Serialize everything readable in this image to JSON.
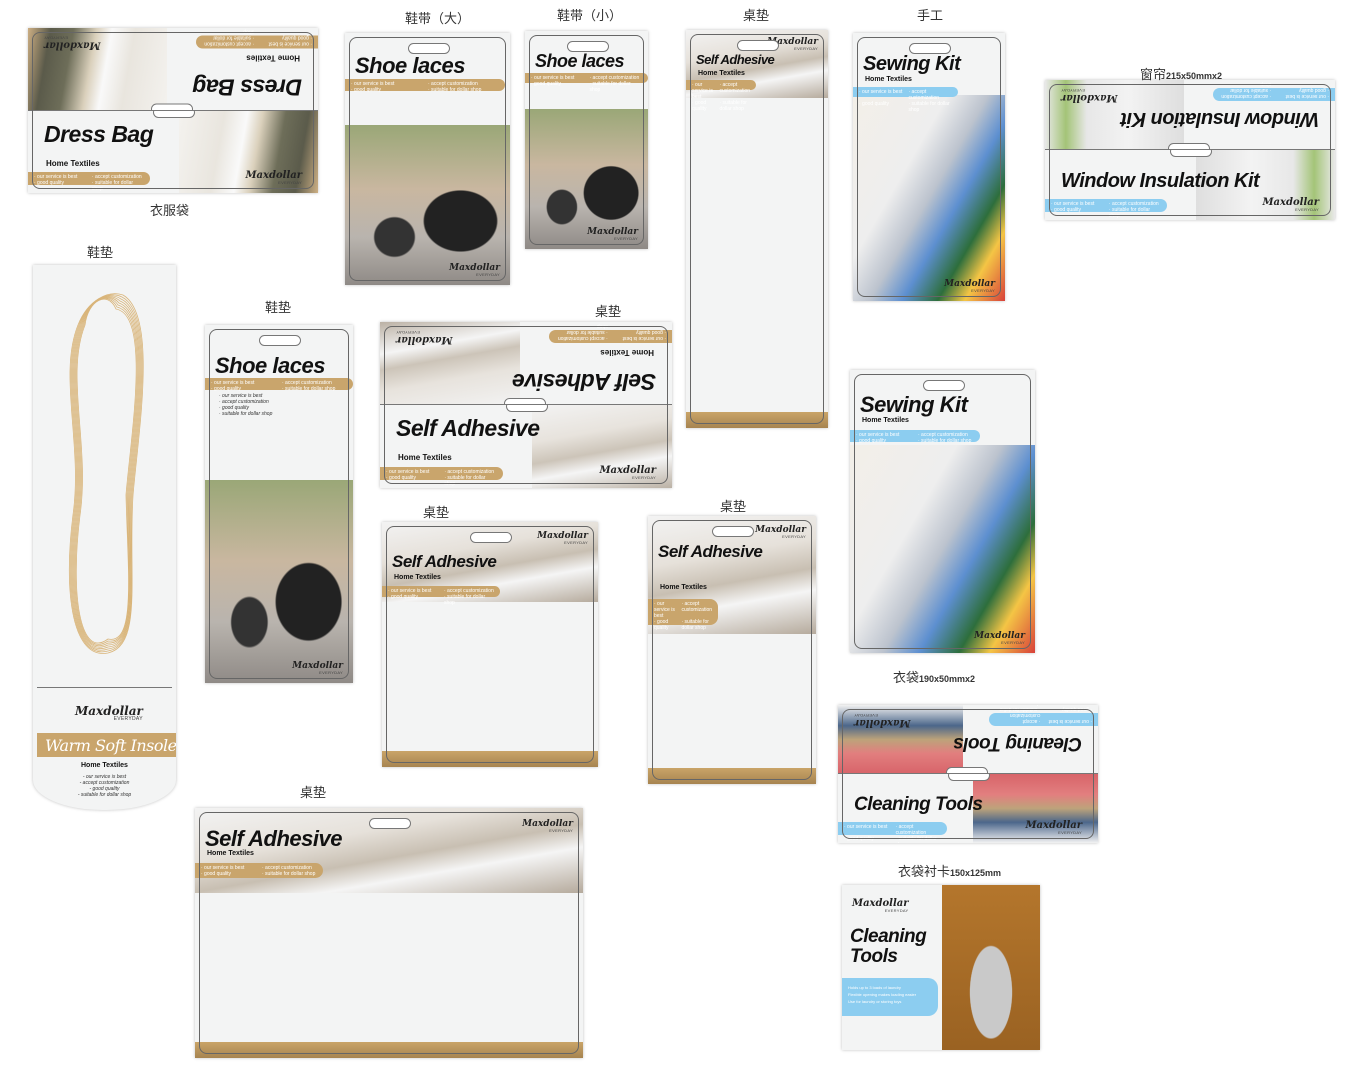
{
  "brand": "Maxdollar",
  "brand_tagline": "EVERYDAY",
  "bullets": [
    "our service is best",
    "accept customization",
    "good quality",
    "suitable for dollar shop"
  ],
  "colors": {
    "gold": "#c9a56c",
    "blue": "#8ccdf0",
    "text": "#111111"
  },
  "labels": {
    "dress_bag": "衣服袋",
    "shoe_laces_large": "鞋带（大）",
    "shoe_laces_small": "鞋带（小）",
    "desk_pad_1": "桌垫",
    "handcraft": "手工",
    "window_kit": "窗帘",
    "window_kit_size": "215x50mmx2",
    "insole": "鞋垫",
    "insole_2": "鞋垫",
    "desk_pad_2": "桌垫",
    "desk_pad_3": "桌垫",
    "desk_pad_4": "桌垫",
    "desk_pad_5": "桌垫",
    "cleaning_bag": "衣袋",
    "cleaning_bag_size": "190x50mmx2",
    "cleaning_card": "衣袋衬卡",
    "cleaning_card_size": "150x125mm"
  },
  "products": {
    "dress_bag": {
      "title": "Dress Bag",
      "subtitle": "Home Textiles"
    },
    "shoe_laces": {
      "title": "Shoe laces",
      "subtitle": "Home Textiles"
    },
    "self_adhesive": {
      "title": "Self Adhesive",
      "subtitle": "Home Textiles"
    },
    "sewing_kit": {
      "title": "Sewing Kit",
      "subtitle": "Home Textiles"
    },
    "window_kit": {
      "title": "Window Insulation Kit"
    },
    "insole": {
      "title": "Warm Soft Insole",
      "subtitle": "Home Textiles"
    },
    "cleaning_tools": {
      "title": "Cleaning Tools"
    },
    "cleaning_card": {
      "title": "Cleaning Tools",
      "features": [
        "Holds up to 3 loads of laundry",
        "Flexible opening makes loading easier",
        "Use for laundry or storing toys"
      ]
    }
  }
}
